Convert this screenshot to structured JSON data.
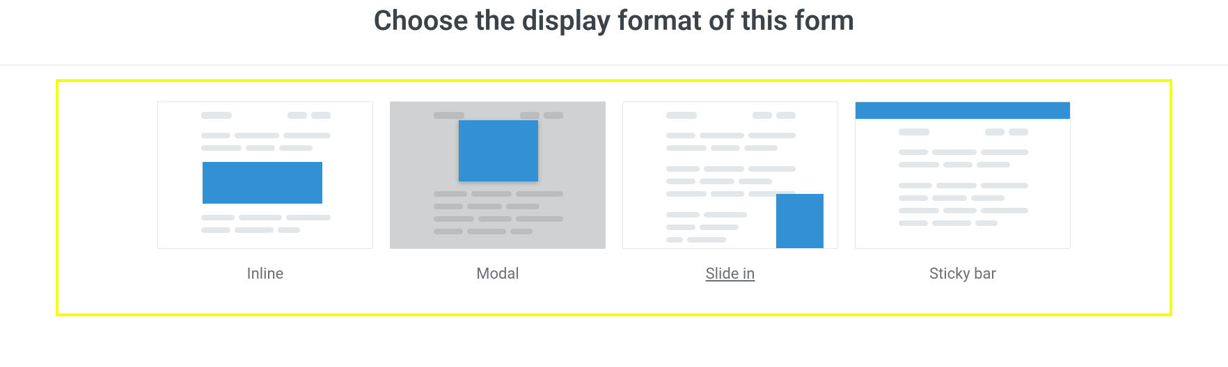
{
  "title": "Choose the display format of this form",
  "options": {
    "inline": {
      "label": "Inline"
    },
    "modal": {
      "label": "Modal"
    },
    "slidein": {
      "label": "Slide in"
    },
    "stickybar": {
      "label": "Sticky bar"
    }
  },
  "colors": {
    "accent": "#3191d3",
    "highlight_border": "#f6ff00"
  }
}
